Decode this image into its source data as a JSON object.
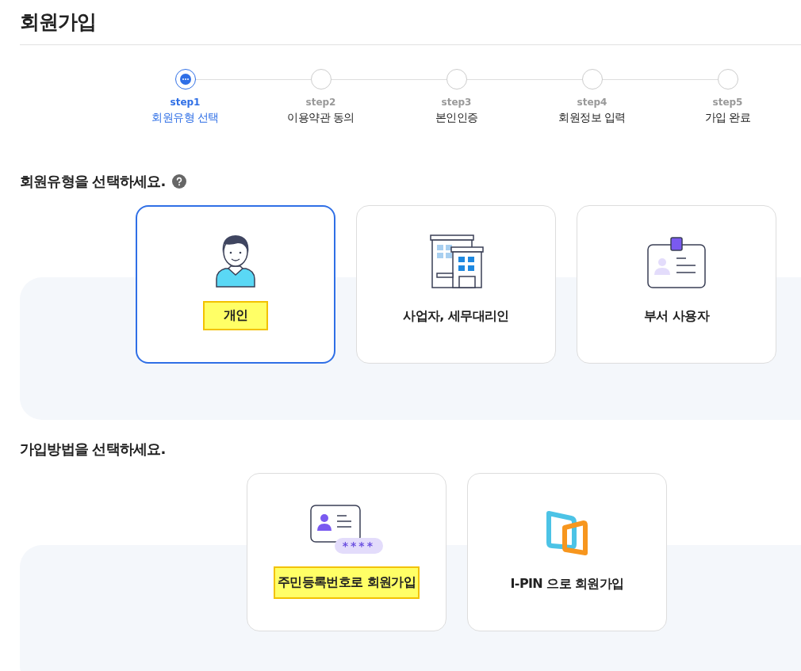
{
  "title": "회원가입",
  "steps": [
    {
      "label": "step1",
      "name": "회원유형 선택",
      "selected": true
    },
    {
      "label": "step2",
      "name": "이용약관 동의",
      "selected": false
    },
    {
      "label": "step3",
      "name": "본인인증",
      "selected": false
    },
    {
      "label": "step4",
      "name": "회원정보 입력",
      "selected": false
    },
    {
      "label": "step5",
      "name": "가입 완료",
      "selected": false
    }
  ],
  "member_type": {
    "heading": "회원유형을 선택하세요.",
    "options": [
      {
        "kind": "person",
        "label": "개인",
        "selected": true,
        "highlighted": true
      },
      {
        "kind": "building",
        "label": "사업자, 세무대리인",
        "selected": false,
        "highlighted": false
      },
      {
        "kind": "badge",
        "label": "부서 사용자",
        "selected": false,
        "highlighted": false
      }
    ]
  },
  "join_method": {
    "heading": "가입방법을 선택하세요.",
    "options": [
      {
        "kind": "idcard",
        "label": "주민등록번호로 회원가입",
        "pin_mask": "****",
        "selected": false,
        "highlighted": true
      },
      {
        "kind": "ipin",
        "label": "I-PIN 으로 회원가입",
        "selected": false,
        "highlighted": false
      }
    ]
  }
}
